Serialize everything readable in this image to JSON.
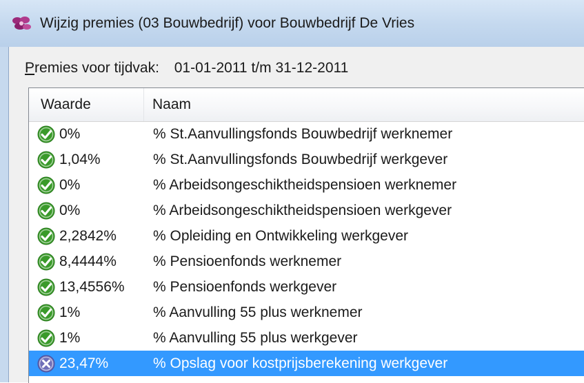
{
  "window": {
    "title": "Wijzig premies (03 Bouwbedrijf) voor Bouwbedrijf De Vries",
    "icon": "app-flower-icon"
  },
  "period": {
    "label_accel": "P",
    "label_rest": "remies voor tijdvak:",
    "value": "01-01-2011 t/m 31-12-2011"
  },
  "list": {
    "columns": [
      "Waarde",
      "Naam"
    ],
    "rows": [
      {
        "status": "check",
        "value": "0%",
        "name": "% St.Aanvullingsfonds Bouwbedrijf werknemer"
      },
      {
        "status": "check",
        "value": "1,04%",
        "name": "% St.Aanvullingsfonds Bouwbedrijf werkgever"
      },
      {
        "status": "check",
        "value": "0%",
        "name": "% Arbeidsongeschiktheidspensioen werknemer"
      },
      {
        "status": "check",
        "value": "0%",
        "name": "% Arbeidsongeschiktheidspensioen werkgever"
      },
      {
        "status": "check",
        "value": "2,2842%",
        "name": "% Opleiding en Ontwikkeling werkgever"
      },
      {
        "status": "check",
        "value": "8,4444%",
        "name": "% Pensioenfonds werknemer"
      },
      {
        "status": "check",
        "value": "13,4556%",
        "name": "% Pensioenfonds werkgever"
      },
      {
        "status": "check",
        "value": "1%",
        "name": "% Aanvulling 55 plus werknemer"
      },
      {
        "status": "check",
        "value": "1%",
        "name": "% Aanvulling 55 plus werkgever"
      },
      {
        "status": "cross",
        "value": "23,47%",
        "name": "% Opslag voor kostprijsberekening werkgever",
        "selected": true
      }
    ]
  },
  "colors": {
    "check": "#3a9a2a",
    "cross": "#6f6fb8",
    "selection": "#3399ff"
  }
}
